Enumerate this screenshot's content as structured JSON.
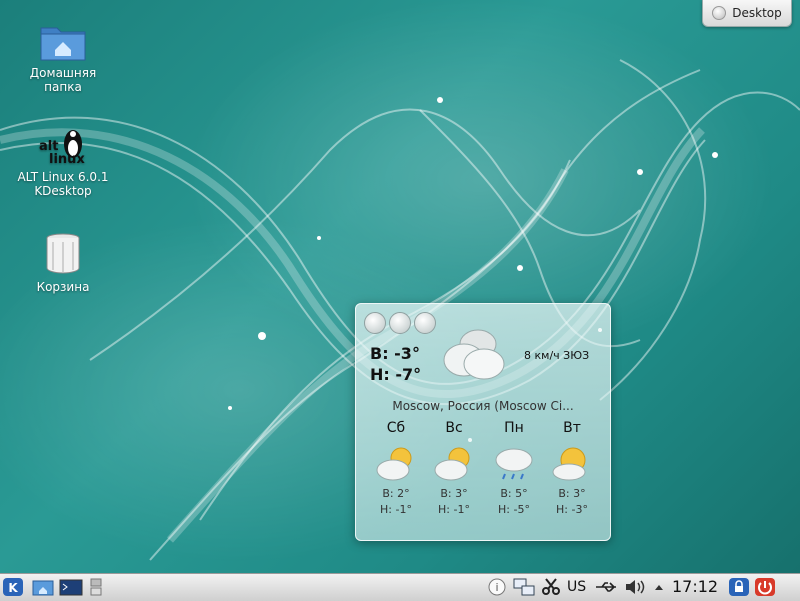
{
  "desktop": {
    "icons": [
      {
        "label": "Домашняя папка",
        "icon": "home-folder-icon"
      },
      {
        "label": "ALT Linux 6.0.1 KDesktop",
        "icon": "alt-linux-icon"
      },
      {
        "label": "Корзина",
        "icon": "trash-icon"
      }
    ],
    "desktop_button": "Desktop"
  },
  "weather": {
    "today_high": "В:  -3°",
    "today_low": "Н:  -7°",
    "wind": "8 км/ч ЗЮЗ",
    "location": "Moscow, Россия (Moscow Ci...",
    "days": [
      {
        "name": "Сб",
        "high": "В: 2°",
        "low": "Н: -1°",
        "icon": "partly-cloudy-icon"
      },
      {
        "name": "Вс",
        "high": "В: 3°",
        "low": "Н: -1°",
        "icon": "partly-cloudy-icon"
      },
      {
        "name": "Пн",
        "high": "В: 5°",
        "low": "Н: -5°",
        "icon": "rain-cloud-icon"
      },
      {
        "name": "Вт",
        "high": "В: 3°",
        "low": "Н: -3°",
        "icon": "sun-cloud-icon"
      }
    ]
  },
  "taskbar": {
    "keyboard_layout": "US",
    "clock": "17:12"
  }
}
